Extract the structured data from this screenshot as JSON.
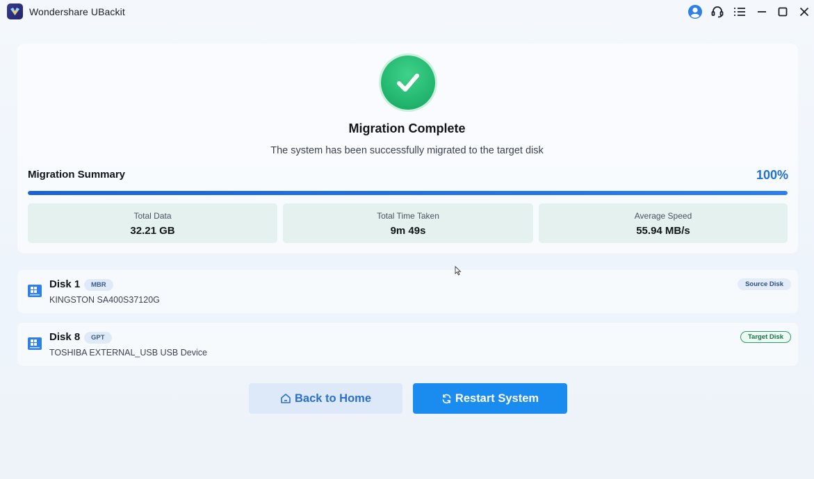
{
  "window": {
    "app_title": "Wondershare UBackit",
    "icons": [
      "account-icon",
      "support-icon",
      "menu-icon",
      "minimize-icon",
      "maximize-icon",
      "close-icon"
    ]
  },
  "migration": {
    "title": "Migration Complete",
    "subtitle": "The system has been successfully migrated to the target disk",
    "summary_label": "Migration Summary",
    "progress_percent": 100,
    "progress_text": "100%",
    "stats": [
      {
        "label": "Total Data",
        "value": "32.21 GB"
      },
      {
        "label": "Total Time Taken",
        "value": "9m 49s"
      },
      {
        "label": "Average Speed",
        "value": "55.94 MB/s"
      }
    ]
  },
  "disks": [
    {
      "name": "Disk 1",
      "partition_style": "MBR",
      "model": "KINGSTON SA400S37120G",
      "role": "Source Disk"
    },
    {
      "name": "Disk 8",
      "partition_style": "GPT",
      "model": "TOSHIBA EXTERNAL_USB USB Device",
      "role": "Target Disk"
    }
  ],
  "actions": {
    "back_home_label": "Back to Home",
    "restart_label": "Restart System"
  },
  "colors": {
    "accent": "#1a8cf0",
    "success": "#20b36b",
    "progress": "#1b62d8"
  }
}
